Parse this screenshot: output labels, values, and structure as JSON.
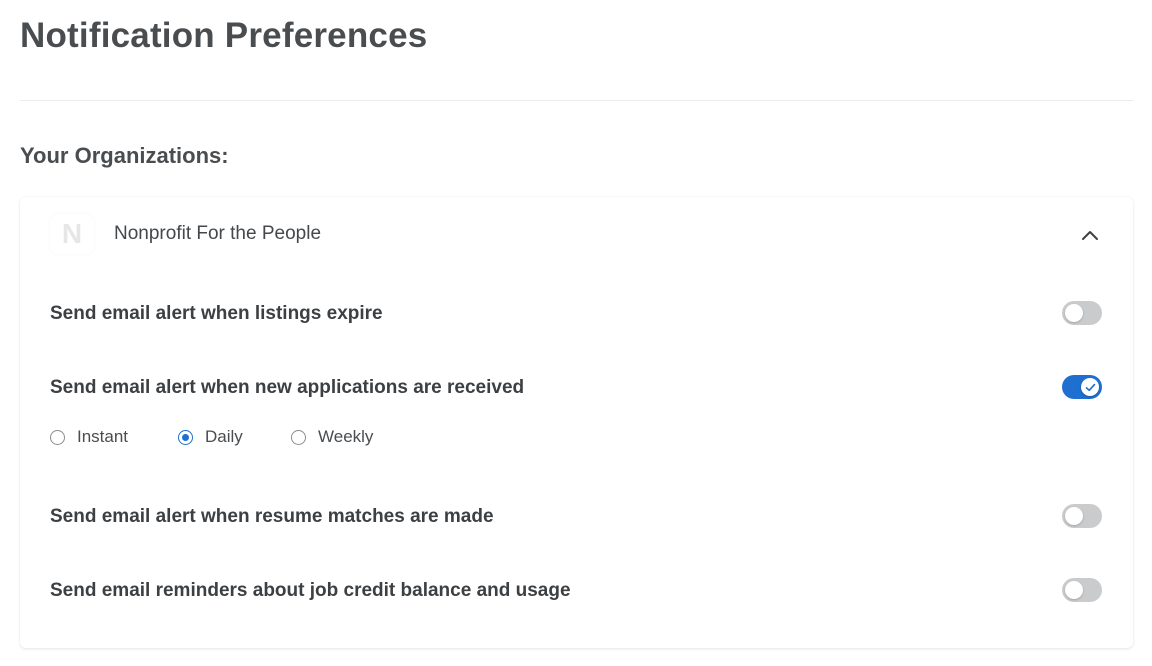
{
  "page": {
    "title": "Notification Preferences",
    "section_title": "Your Organizations:"
  },
  "organization": {
    "initial": "N",
    "name": "Nonprofit For the People",
    "expanded": true,
    "collapse_icon": "chevron-up-icon"
  },
  "preferences": [
    {
      "label": "Send email alert when listings expire",
      "enabled": false
    },
    {
      "label": "Send email alert when new applications are received",
      "enabled": true
    },
    {
      "label": "Send email alert when resume matches are made",
      "enabled": false
    },
    {
      "label": "Send email reminders about job credit balance and usage",
      "enabled": false
    }
  ],
  "frequency": {
    "options": [
      "Instant",
      "Daily",
      "Weekly"
    ],
    "selected": "Daily"
  },
  "colors": {
    "accent": "#1f6fd1",
    "toggle_off": "#c9cbcd",
    "text": "#3d4043"
  }
}
